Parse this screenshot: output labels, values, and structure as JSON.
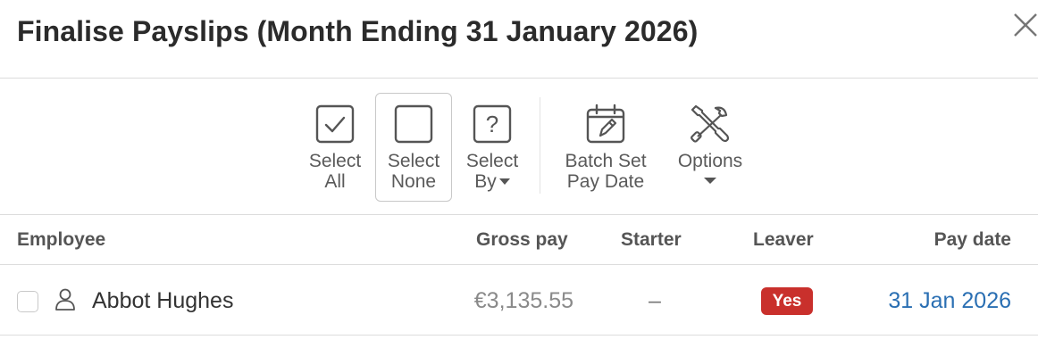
{
  "dialog": {
    "title": "Finalise Payslips (Month Ending 31 January 2026)",
    "close_icon": "close-icon"
  },
  "toolbar": {
    "select_all": {
      "line1": "Select",
      "line2": "All",
      "icon": "checkbox-checked-icon"
    },
    "select_none": {
      "line1": "Select",
      "line2": "None",
      "icon": "checkbox-empty-icon"
    },
    "select_by": {
      "line1": "Select",
      "line2": "By",
      "icon": "question-box-icon"
    },
    "batch_set_pay_date": {
      "line1": "Batch Set",
      "line2": "Pay Date",
      "icon": "calendar-edit-icon"
    },
    "options": {
      "line1": "Options",
      "icon": "tools-icon"
    }
  },
  "table": {
    "columns": {
      "employee": "Employee",
      "gross_pay": "Gross pay",
      "starter": "Starter",
      "leaver": "Leaver",
      "pay_date": "Pay date"
    },
    "rows": [
      {
        "employee": "Abbot Hughes",
        "gross_pay": "€3,135.55",
        "starter": "–",
        "leaver": "Yes",
        "pay_date": "31 Jan 2026"
      }
    ]
  },
  "colors": {
    "accent_link": "#2a6fb3",
    "leaver_badge": "#c9302c",
    "border": "#dcdcdc"
  }
}
